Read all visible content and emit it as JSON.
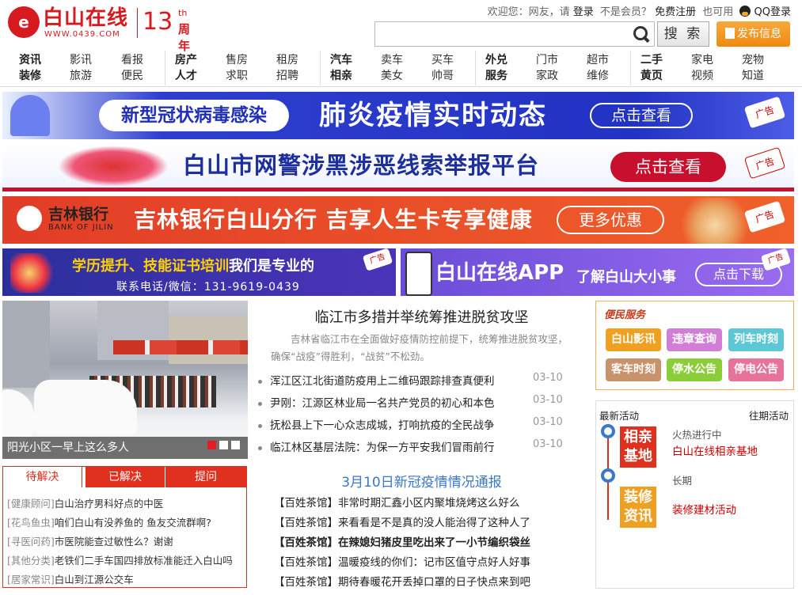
{
  "header": {
    "logo": {
      "glyph": "e",
      "name": "白山在线",
      "url": "WWW.0439.COM",
      "anniv_num": "13",
      "anniv_th": "th",
      "anniv_label": "周年"
    },
    "welcome": "欢迎您：网友，请",
    "login": "登录",
    "not_member": "不是会员？",
    "register": "免费注册",
    "also": "也可用",
    "qq_login": "QQ登录",
    "search": {
      "placeholder": "",
      "button": "搜 索"
    },
    "post_button": "发布信息"
  },
  "nav": [
    {
      "top": [
        "资讯",
        "影讯",
        "看报"
      ],
      "bottom": [
        "装修",
        "旅游",
        "便民"
      ]
    },
    {
      "top": [
        "房产",
        "售房",
        "租房"
      ],
      "bottom": [
        "人才",
        "求职",
        "招聘"
      ]
    },
    {
      "top": [
        "汽车",
        "卖车",
        "买车"
      ],
      "bottom": [
        "相亲",
        "美女",
        "帅哥"
      ]
    },
    {
      "top": [
        "外兑",
        "门市",
        "超市"
      ],
      "bottom": [
        "服务",
        "家政",
        "维修"
      ]
    },
    {
      "top": [
        "二手",
        "家电",
        "宠物"
      ],
      "bottom": [
        "黄页",
        "视频",
        "知道"
      ]
    }
  ],
  "banners": {
    "b1": {
      "pill": "新型冠状病毒感染",
      "title": "肺炎疫情实时动态",
      "btn": "点击查看",
      "tag": "广告"
    },
    "b2": {
      "title": "白山市网警涉黑涉恶线索举报平台",
      "btn": "点击查看",
      "tag": "广告"
    },
    "b3": {
      "bank_cn": "吉林银行",
      "bank_en": "BANK OF JILIN",
      "title": "吉林银行白山分行 吉享人生卡专享健康",
      "btn": "更多优惠",
      "tag": "广告"
    },
    "b4a": {
      "title_yellow": "学历提升、技能证书培训",
      "title_white": "我们是专业的",
      "phone": "联系电话/微信：131-9619-0439",
      "tag": "广告"
    },
    "b4b": {
      "title": "白山在线APP",
      "sub": "了解白山大小事",
      "btn": "点击下载",
      "tag": "广告"
    }
  },
  "slider": {
    "caption": "阳光小区一早上这么多人",
    "active": 0
  },
  "tabs": [
    "待解决",
    "已解决",
    "提问"
  ],
  "qa": [
    {
      "cat": "[健康顾问]",
      "text": "白山治疗男科好点的中医"
    },
    {
      "cat": "[花鸟鱼虫]",
      "text": "咱们白山有没养鱼的 鱼友交流群啊?"
    },
    {
      "cat": "[寻医问药]",
      "text": "市医院能查过敏性么？谢谢"
    },
    {
      "cat": "[其他分类]",
      "text": "老铁们二手车国四排放标准能迁入白山吗"
    },
    {
      "cat": "[居家常识]",
      "text": "白山到江源公交车"
    }
  ],
  "headline": {
    "title": "临江市多措并举统筹推进脱贫攻坚",
    "summary": "吉林省临江市在全面做好疫情防控前提下，统筹推进脱贫攻坚，确保“战疫”得胜利，“战贫”不松劲。"
  },
  "news": [
    {
      "title": "浑江区江北街道防疫用上二维码跟踪排查真便利",
      "date": "03-10"
    },
    {
      "title": "尹刚：江源区林业局一名共产党员的初心和本色",
      "date": "03-10"
    },
    {
      "title": "抚松县上下一心众志成城，打响抗疫的全民战争",
      "date": "03-10"
    },
    {
      "title": "临江林区基层法院：为保一方平安我们冒雨前行",
      "date": "03-10"
    }
  ],
  "subhead": "3月10日新冠疫情情况通报",
  "teahouse": [
    {
      "text": "【百姓茶馆】非常时期汇鑫小区内聚堆烧烤这么好么",
      "bold": false
    },
    {
      "text": "【百姓茶馆】来看看是不是真的没人能治得了这种人了",
      "bold": false
    },
    {
      "text": "【百姓茶馆】在辣媳妇猪皮里吃出来了一小节编织袋丝",
      "bold": true
    },
    {
      "text": "【百姓茶馆】温暖疫线的你们：记市区值守点好人好事",
      "bold": false
    },
    {
      "text": "【百姓茶馆】期待春暖花开丢掉口罩的日子快点来到吧",
      "bold": false
    }
  ],
  "services": {
    "title": "便民服务",
    "items": [
      {
        "label": "白山影讯",
        "color": "#f0a020"
      },
      {
        "label": "违章查询",
        "color": "#d17fd6"
      },
      {
        "label": "列车时刻",
        "color": "#5cc8d6"
      },
      {
        "label": "客车时刻",
        "color": "#c8936a"
      },
      {
        "label": "停水公告",
        "color": "#8ccd3a"
      },
      {
        "label": "停电公告",
        "color": "#e8739a"
      }
    ]
  },
  "activities": {
    "latest": "最新活动",
    "past": "往期活动",
    "items": [
      {
        "box": "相亲基地",
        "box_color": "#e0301e",
        "state": "火热进行中",
        "name": "白山在线相亲基地"
      },
      {
        "box": "装修资讯",
        "box_color": "#f0a020",
        "state": "长期",
        "name": "装修建材活动"
      }
    ]
  }
}
